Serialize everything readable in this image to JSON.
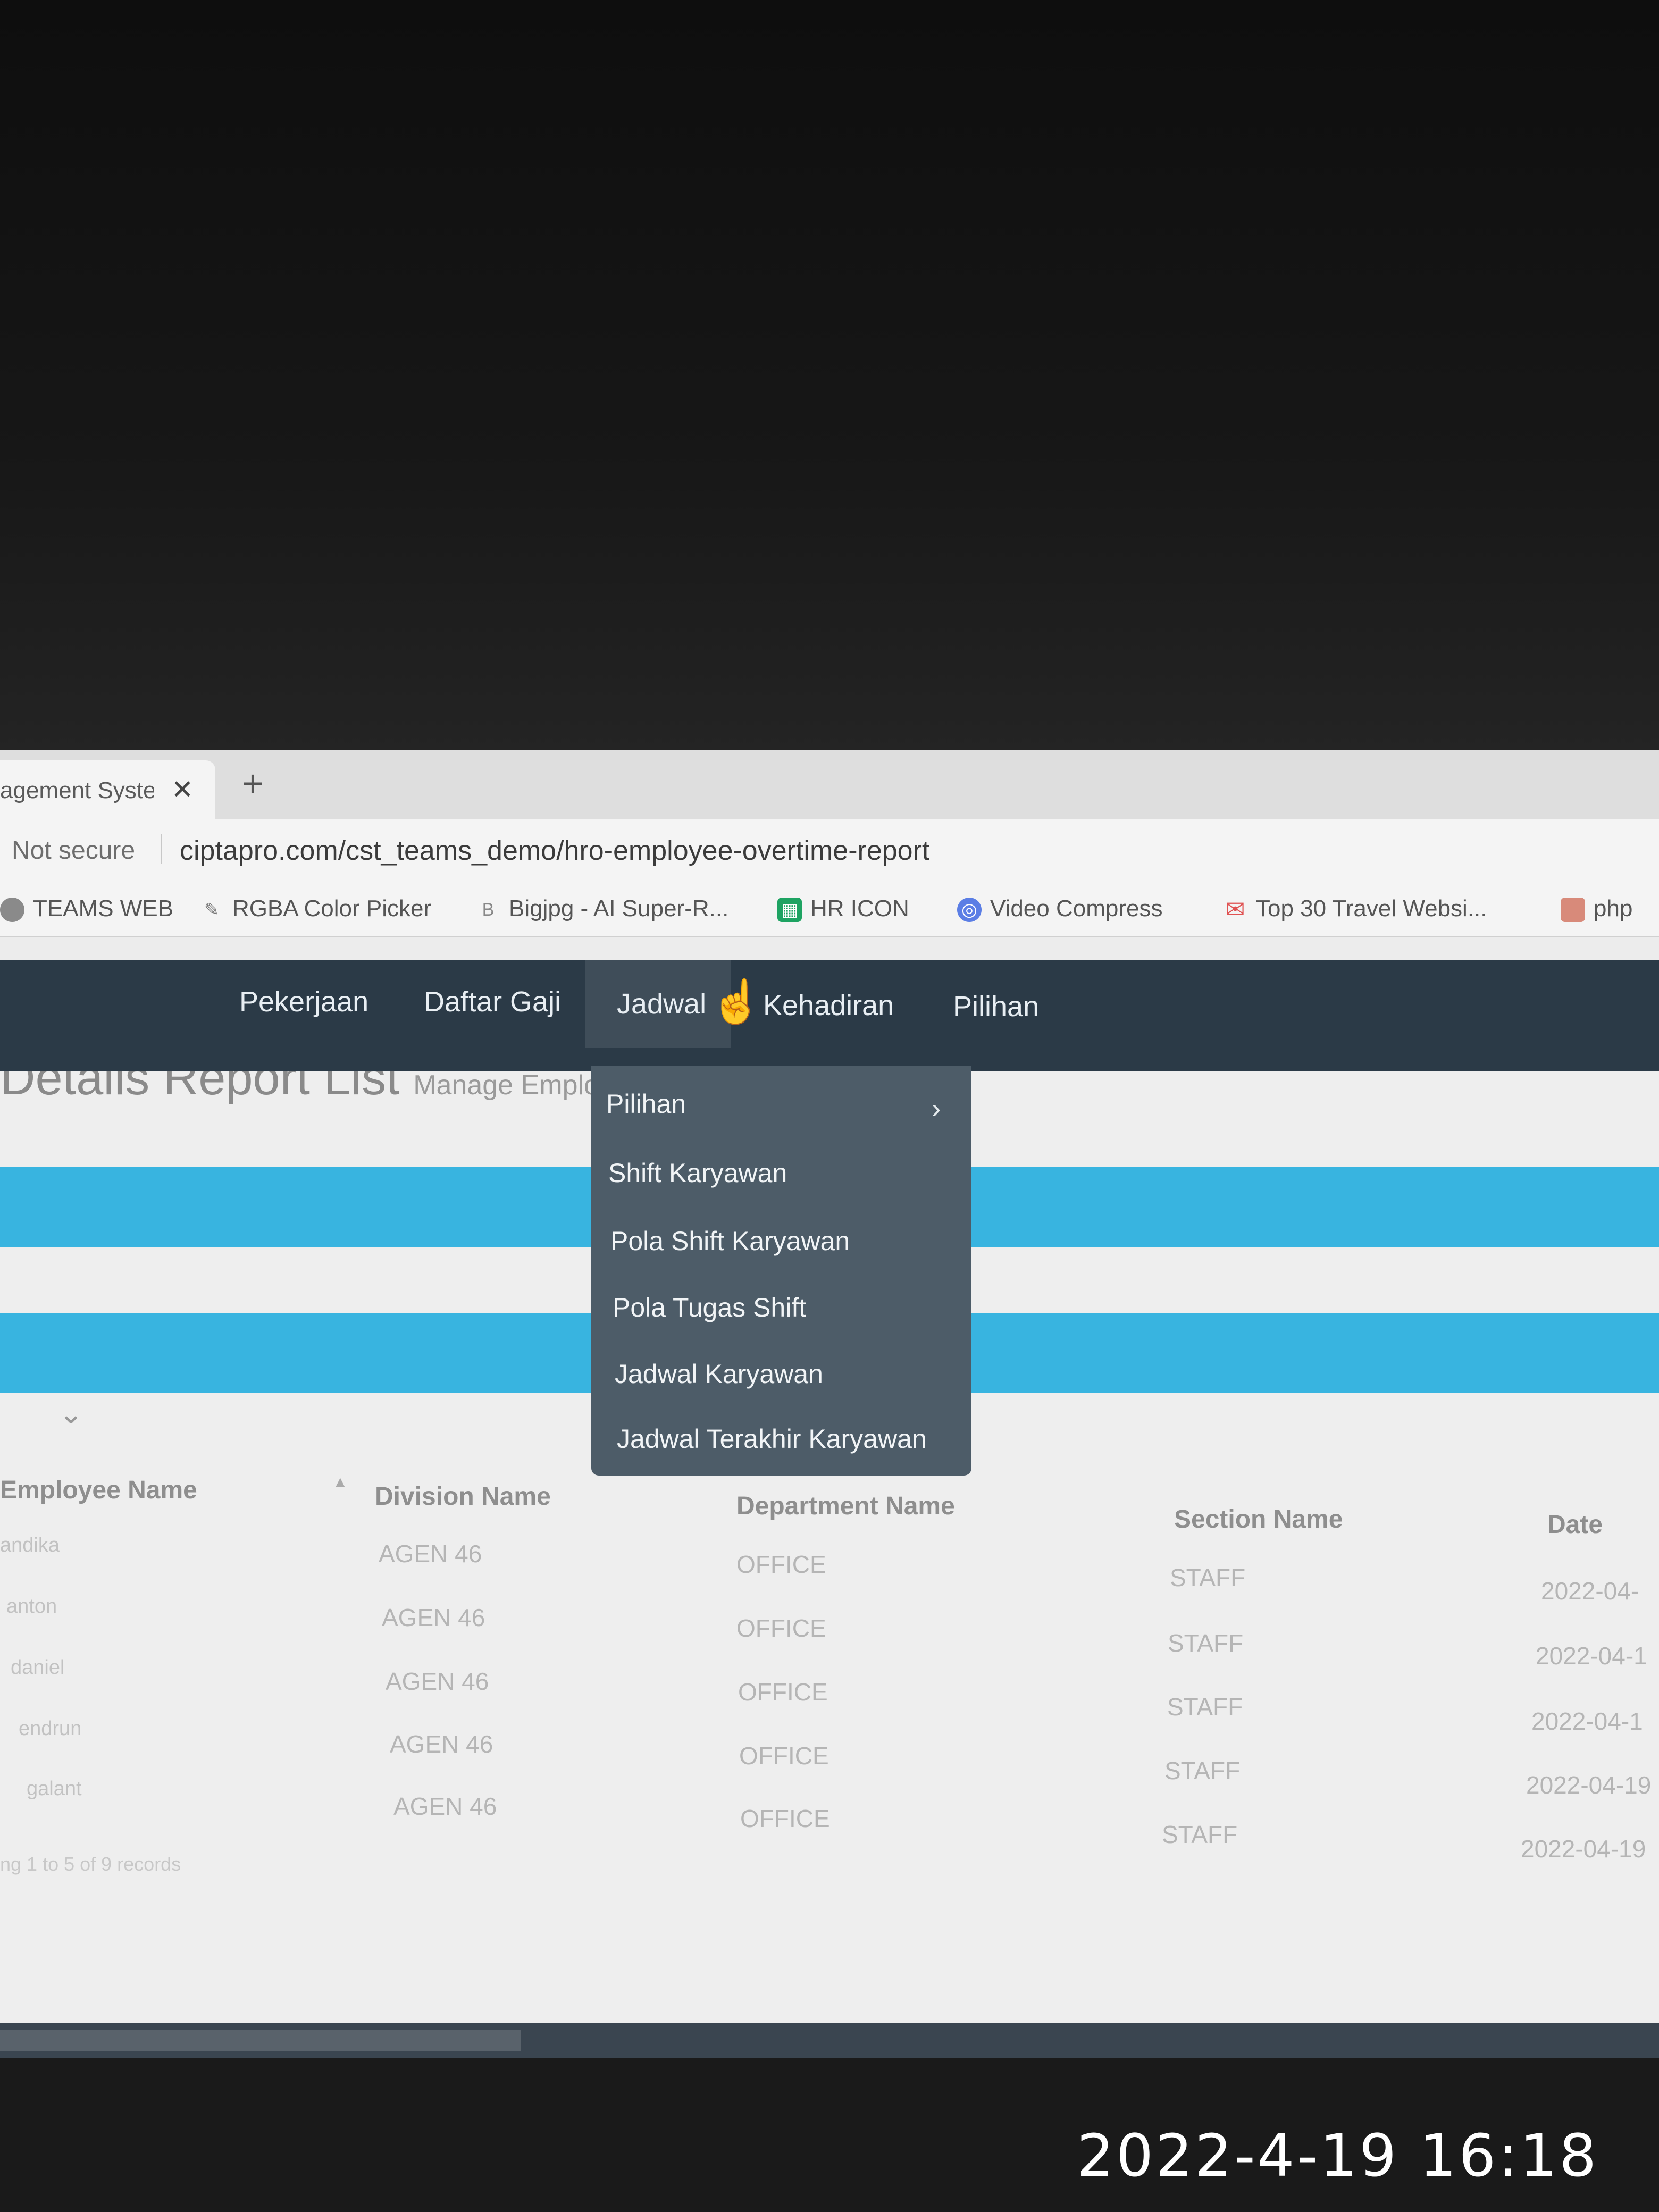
{
  "browser": {
    "tab_title": "agement Syste",
    "tab_close": "✕",
    "new_tab": "+",
    "not_secure": "Not secure",
    "url": "ciptapro.com/cst_teams_demo/hro-employee-overtime-report",
    "bookmarks": [
      {
        "label": "TEAMS WEB",
        "icon": "globe-icon"
      },
      {
        "label": "RGBA Color Picker",
        "icon": "eyedropper-icon"
      },
      {
        "label": "Bigjpg - AI Super-R...",
        "icon": "b-icon"
      },
      {
        "label": "HR ICON",
        "icon": "grid-icon"
      },
      {
        "label": "Video Compress",
        "icon": "circle-icon"
      },
      {
        "label": "Top 30 Travel Websi...",
        "icon": "mail-icon"
      },
      {
        "label": "php",
        "icon": "php-icon"
      }
    ]
  },
  "navbar": {
    "items": [
      "Pekerjaan",
      "Daftar Gaji",
      "Jadwal",
      "Kehadiran",
      "Pilihan"
    ],
    "active": "Jadwal"
  },
  "dropdown": {
    "items": [
      "Pilihan",
      "Shift Karyawan",
      "Pola Shift Karyawan",
      "Pola Tugas Shift",
      "Jadwal Karyawan",
      "Jadwal Terakhir Karyawan"
    ],
    "submenu_chevron": "›"
  },
  "page": {
    "heading": "Details Report List",
    "subheading": "Manage Employee"
  },
  "table": {
    "headers": [
      "Employee Name",
      "Division Name",
      "Department Name",
      "Section Name",
      "Date"
    ],
    "sort_indicator": "▲",
    "rows": [
      [
        "andika",
        "AGEN 46",
        "OFFICE",
        "STAFF",
        "2022-04-"
      ],
      [
        "anton",
        "AGEN 46",
        "OFFICE",
        "STAFF",
        "2022-04-1"
      ],
      [
        "daniel",
        "AGEN 46",
        "OFFICE",
        "STAFF",
        "2022-04-1"
      ],
      [
        "endrun",
        "AGEN 46",
        "OFFICE",
        "STAFF",
        "2022-04-19"
      ],
      [
        "galant",
        "AGEN 46",
        "OFFICE",
        "STAFF",
        "2022-04-19"
      ]
    ],
    "footer": "ng 1 to 5 of 9 records"
  },
  "photo_timestamp": "2022-4-19 16:18",
  "colors": {
    "navbar": "#2b3a47",
    "dropdown": "#4d5c68",
    "band": "#38b4e0",
    "hr_icon": "#1ea362",
    "mail_icon": "#e05252",
    "circle_icon": "#5b7ee5"
  }
}
